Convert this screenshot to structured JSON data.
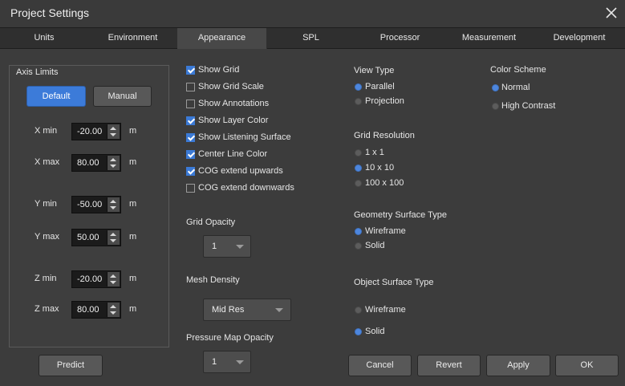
{
  "window": {
    "title": "Project Settings"
  },
  "tabs": [
    "Units",
    "Environment",
    "Appearance",
    "SPL",
    "Processor",
    "Measurement",
    "Development"
  ],
  "active_tab": "Appearance",
  "axis_limits": {
    "title": "Axis Limits",
    "default_label": "Default",
    "manual_label": "Manual",
    "unit": "m",
    "rows": [
      {
        "label": "X min",
        "value": "-20.00"
      },
      {
        "label": "X max",
        "value": "80.00"
      },
      {
        "label": "Y min",
        "value": "-50.00"
      },
      {
        "label": "Y max",
        "value": "50.00"
      },
      {
        "label": "Z min",
        "value": "-20.00"
      },
      {
        "label": "Z max",
        "value": "80.00"
      }
    ],
    "predict_label": "Predict"
  },
  "checkboxes": [
    {
      "label": "Show Grid",
      "checked": true
    },
    {
      "label": "Show Grid Scale",
      "checked": false
    },
    {
      "label": "Show Annotations",
      "checked": false
    },
    {
      "label": "Show Layer Color",
      "checked": true
    },
    {
      "label": "Show Listening Surface",
      "checked": true
    },
    {
      "label": "Center Line Color",
      "checked": true
    },
    {
      "label": "COG extend upwards",
      "checked": true
    },
    {
      "label": "COG extend downwards",
      "checked": false
    }
  ],
  "grid_opacity": {
    "label": "Grid Opacity",
    "value": "1"
  },
  "mesh_density": {
    "label": "Mesh Density",
    "value": "Mid Res"
  },
  "pressure_map_opacity": {
    "label": "Pressure Map Opacity",
    "value": "1"
  },
  "view_type": {
    "title": "View Type",
    "options": [
      "Parallel",
      "Projection"
    ],
    "selected": "Parallel"
  },
  "grid_resolution": {
    "title": "Grid Resolution",
    "options": [
      "1 x 1",
      "10 x 10",
      "100 x 100"
    ],
    "selected": "10 x 10"
  },
  "geometry_surface_type": {
    "title": "Geometry Surface Type",
    "options": [
      "Wireframe",
      "Solid"
    ],
    "selected": "Wireframe"
  },
  "object_surface_type": {
    "title": "Object Surface Type",
    "options": [
      "Wireframe",
      "Solid"
    ],
    "selected": "Solid"
  },
  "color_scheme": {
    "title": "Color Scheme",
    "options": [
      "Normal",
      "High Contrast"
    ],
    "selected": "Normal"
  },
  "footer": {
    "cancel": "Cancel",
    "revert": "Revert",
    "apply": "Apply",
    "ok": "OK"
  },
  "colors": {
    "accent": "#3c7bd9",
    "background": "#3c3c3c"
  },
  "icons": {
    "close": "close-icon",
    "spin": "spinner-arrows-icon",
    "dropdown": "chevron-down-icon"
  }
}
